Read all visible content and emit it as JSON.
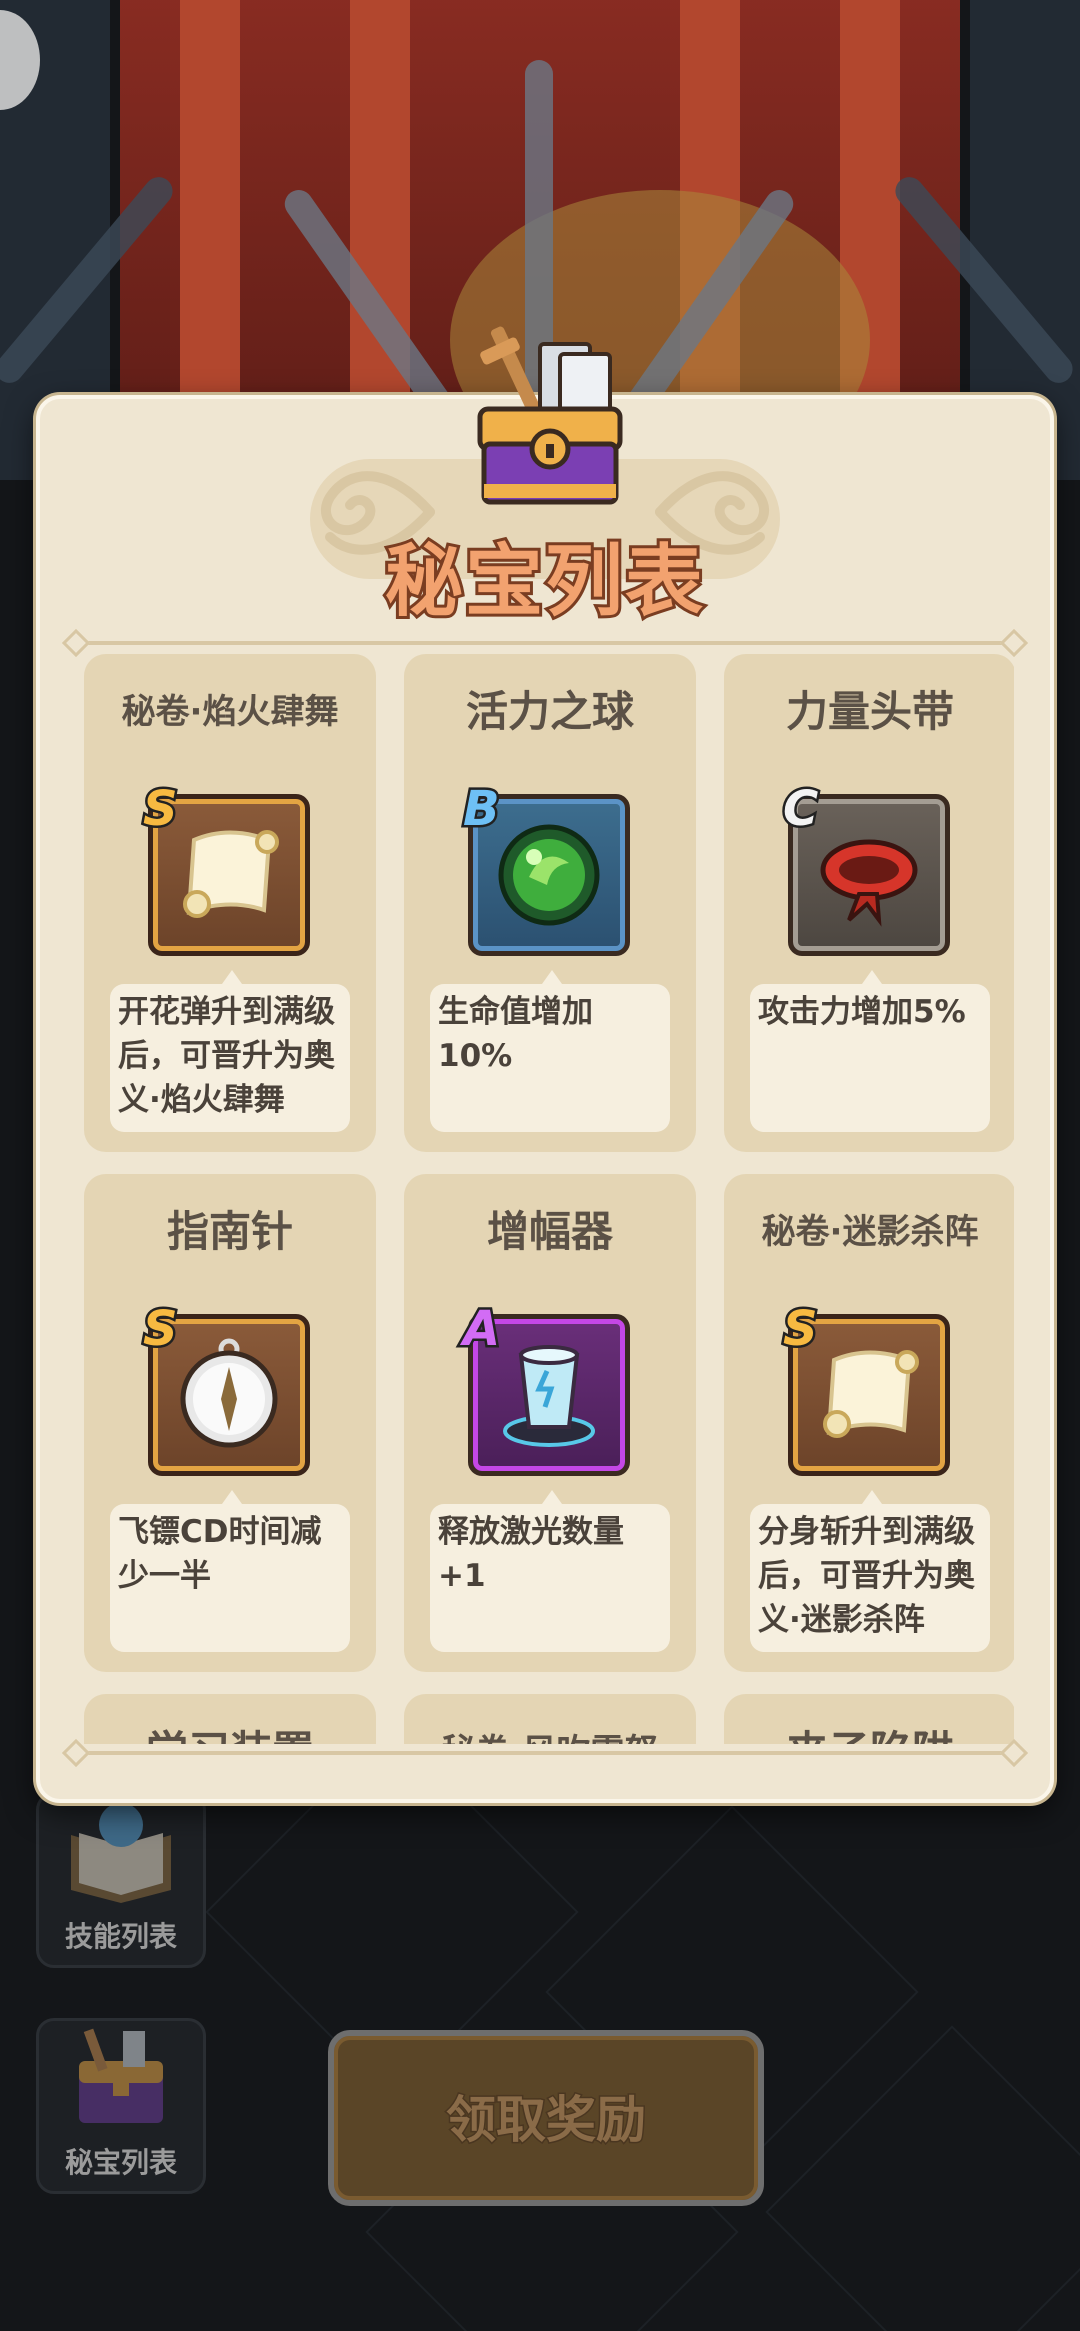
{
  "modal": {
    "title": "秘宝列表"
  },
  "colors": {
    "modal_bg": "#efe6d2",
    "card_bg": "#e4d5b4",
    "title_fill": "#f2a26f",
    "grade_s": "#e3a443",
    "grade_a": "#c447e6",
    "grade_b": "#5b93c6",
    "grade_c": "#a49d93"
  },
  "treasures": [
    {
      "name": "秘卷·焰火肆舞",
      "grade": "S",
      "icon": "scroll-icon",
      "desc": "开花弹升到满级后，可晋升为奥义·焰火肆舞"
    },
    {
      "name": "活力之球",
      "grade": "B",
      "icon": "green-orb-icon",
      "desc": "生命值增加10%"
    },
    {
      "name": "力量头带",
      "grade": "C",
      "icon": "red-headband-icon",
      "desc": "攻击力增加5%"
    },
    {
      "name": "指南针",
      "grade": "S",
      "icon": "compass-icon",
      "desc": "飞镖CD时间减少一半"
    },
    {
      "name": "增幅器",
      "grade": "A",
      "icon": "amplifier-icon",
      "desc": "释放激光数量+1"
    },
    {
      "name": "秘卷·迷影杀阵",
      "grade": "S",
      "icon": "scroll-icon",
      "desc": "分身斩升到满级后，可晋升为奥义·迷影杀阵"
    },
    {
      "name": "学习装置",
      "grade": "",
      "icon": "",
      "desc": ""
    },
    {
      "name": "秘卷·风吹雪怒",
      "grade": "",
      "icon": "",
      "desc": ""
    },
    {
      "name": "夹子陷阱",
      "grade": "",
      "icon": "",
      "desc": ""
    }
  ],
  "side_buttons": {
    "skills_label": "技能列表",
    "treasures_label": "秘宝列表"
  },
  "claim_button": {
    "label": "领取奖励"
  }
}
